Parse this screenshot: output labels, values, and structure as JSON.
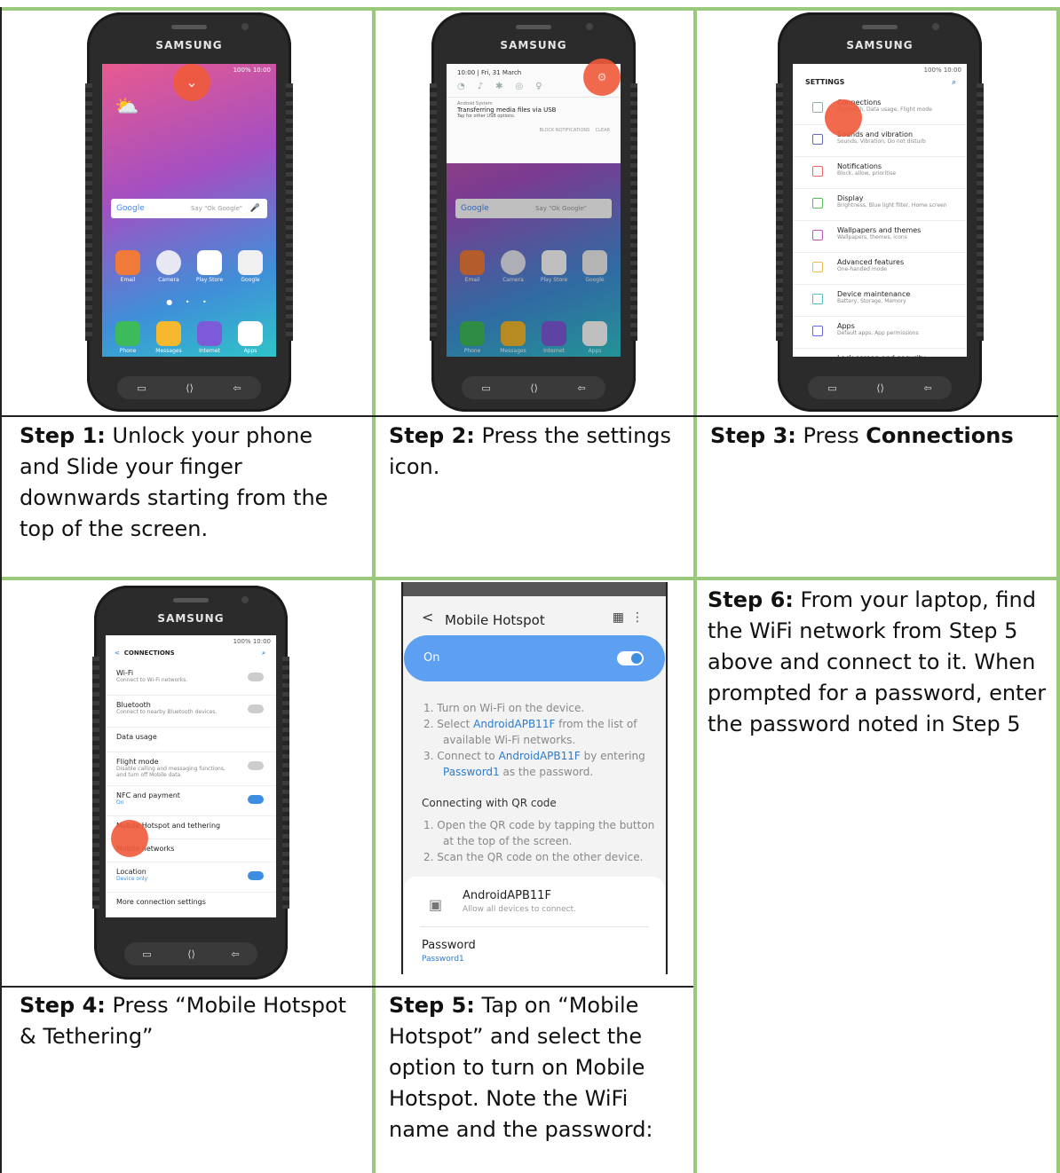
{
  "steps": [
    {
      "label": "Step 1:",
      "text": " Unlock your phone and Slide your finger downwards starting from the top of the screen."
    },
    {
      "label": "Step 2:",
      "text": " Press the settings icon."
    },
    {
      "label": "Step 3:",
      "text": " Press ",
      "bold": "Connections"
    },
    {
      "label": "Step 4:",
      "text": " Press “Mobile Hotspot & Tethering”"
    },
    {
      "label": "Step 5:",
      "text": " Tap on “Mobile Hotspot” and select the option to turn on Mobile Hotspot. Note the WiFi name and the password:"
    },
    {
      "label": "Step 6:",
      "text": " From your laptop, find the WiFi network from Step 5 above and connect to it. When prompted for a password, enter the password noted in Step 5"
    }
  ],
  "phone": {
    "brand": "SAMSUNG",
    "status": "100% 10:00"
  },
  "home": {
    "google": "Google",
    "say": "Say \"Ok Google\"",
    "row1": [
      "Email",
      "Camera",
      "Play Store",
      "Google"
    ],
    "row2": [
      "Phone",
      "Messages",
      "Internet",
      "Apps"
    ]
  },
  "shade": {
    "date": "10:00 | Fri, 31 March",
    "src": "Android System",
    "title": "Transferring media files via USB",
    "sub": "Tap for other USB options.",
    "block": "BLOCK NOTIFICATIONS",
    "clear": "CLEAR"
  },
  "settings": {
    "header": "SETTINGS",
    "items": [
      {
        "t": "Connections",
        "s": "Bluetooth, Data usage, Flight mode"
      },
      {
        "t": "Sounds and vibration",
        "s": "Sounds, Vibration, Do not disturb"
      },
      {
        "t": "Notifications",
        "s": "Block, allow, prioritise"
      },
      {
        "t": "Display",
        "s": "Brightness, Blue light filter, Home screen"
      },
      {
        "t": "Wallpapers and themes",
        "s": "Wallpapers, themes, icons"
      },
      {
        "t": "Advanced features",
        "s": "One-handed mode"
      },
      {
        "t": "Device maintenance",
        "s": "Battery, Storage, Memory"
      },
      {
        "t": "Apps",
        "s": "Default apps, App permissions"
      },
      {
        "t": "Lock screen and security",
        "s": ""
      }
    ]
  },
  "connections": {
    "header": "CONNECTIONS",
    "items": [
      {
        "t": "Wi-Fi",
        "s": "Connect to Wi-Fi networks."
      },
      {
        "t": "Bluetooth",
        "s": "Connect to nearby Bluetooth devices."
      },
      {
        "t": "Data usage",
        "s": ""
      },
      {
        "t": "Flight mode",
        "s": "Disable calling and messaging functions, and turn off Mobile data."
      },
      {
        "t": "NFC and payment",
        "s": "On"
      },
      {
        "t": "Mobile Hotspot and tethering",
        "s": ""
      },
      {
        "t": "Mobile networks",
        "s": ""
      },
      {
        "t": "Location",
        "s": "Device only"
      },
      {
        "t": "More connection settings",
        "s": ""
      }
    ]
  },
  "hotspot": {
    "title": "Mobile Hotspot",
    "on": "On",
    "i1": "1. Turn on Wi-Fi on the device.",
    "i2a": "2. Select ",
    "i2b": "AndroidAPB11F",
    "i2c": " from the list of",
    "i2d": "available Wi-Fi networks.",
    "i3a": "3. Connect to ",
    "i3b": "AndroidAPB11F",
    "i3c": " by entering",
    "i3d": "Password1",
    "i3e": " as the password.",
    "qr": "Connecting with QR code",
    "q1": "1. Open the QR code by tapping the button",
    "q1b": "at the top of the screen.",
    "q2": "2. Scan the QR code on the other device.",
    "ssid": "AndroidAPB11F",
    "allow": "Allow all devices to connect.",
    "pwlabel": "Password",
    "pw": "Password1"
  }
}
